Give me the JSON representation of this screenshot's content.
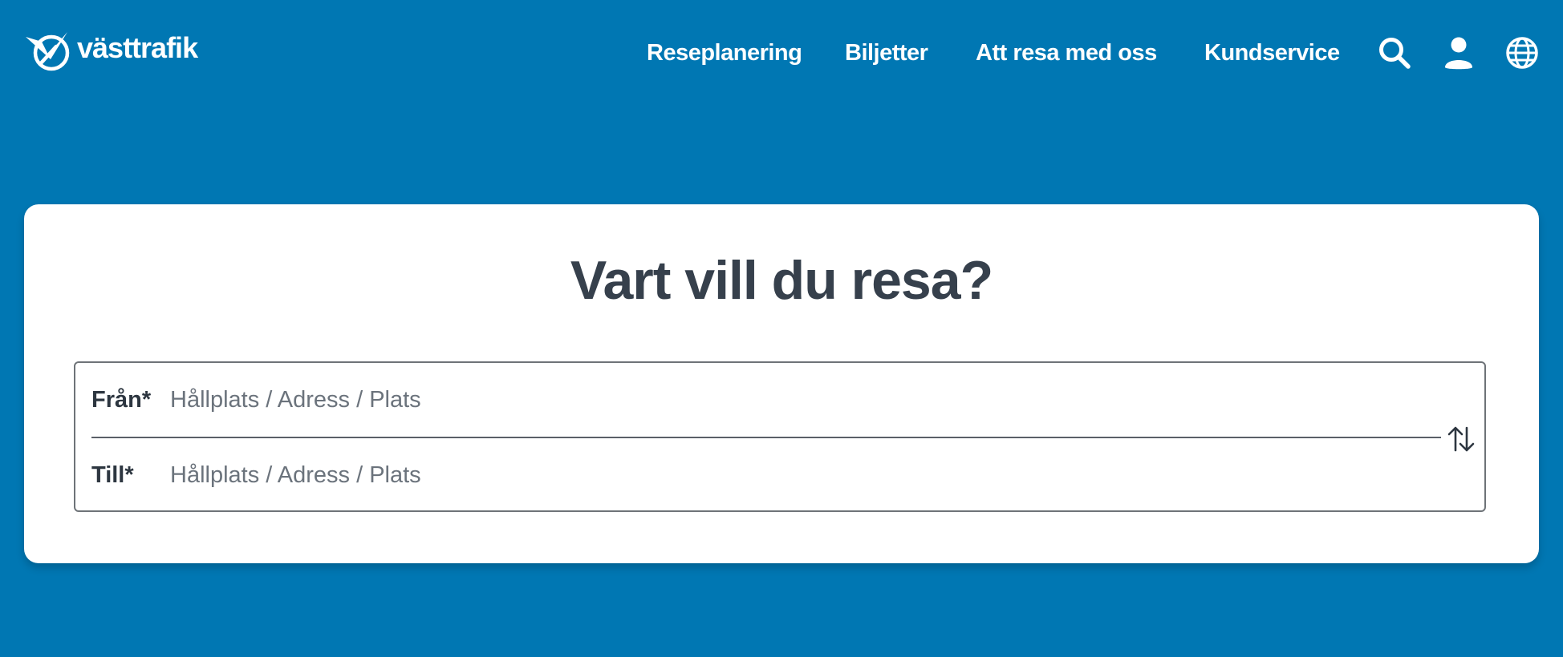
{
  "brand": {
    "name": "västtrafik"
  },
  "nav": {
    "items": [
      {
        "label": "Reseplanering"
      },
      {
        "label": "Biljetter"
      },
      {
        "label": "Att resa med oss"
      },
      {
        "label": "Kundservice"
      }
    ],
    "icons": [
      "search-icon",
      "user-icon",
      "globe-icon"
    ]
  },
  "planner": {
    "title": "Vart vill du resa?",
    "from": {
      "label": "Från*",
      "placeholder": "Hållplats / Adress / Plats",
      "value": ""
    },
    "to": {
      "label": "Till*",
      "placeholder": "Hållplats / Adress / Plats",
      "value": ""
    },
    "swap_icon": "swap-vertical-arrows-icon"
  },
  "colors": {
    "background": "#0077b3",
    "card": "#ffffff",
    "heading_text": "#36404c",
    "nav_text": "#ffffff"
  }
}
